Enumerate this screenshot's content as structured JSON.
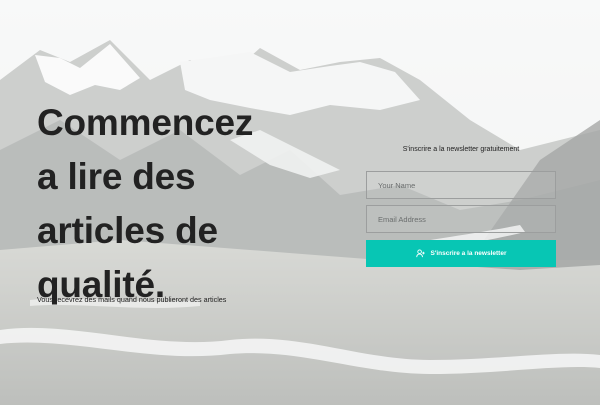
{
  "hero": {
    "headline": "Commencez a lire des articles de qualité.",
    "subtext": "Vous recevrez des mails quand nous publieront des articles"
  },
  "newsletter": {
    "title": "S'inscrire a la newsletter gratuitement",
    "name_placeholder": "Your Name",
    "email_placeholder": "Email Address",
    "button_label": "S'inscrire a la newsletter",
    "button_color": "#07c6b4",
    "button_icon": "add-user-icon"
  }
}
